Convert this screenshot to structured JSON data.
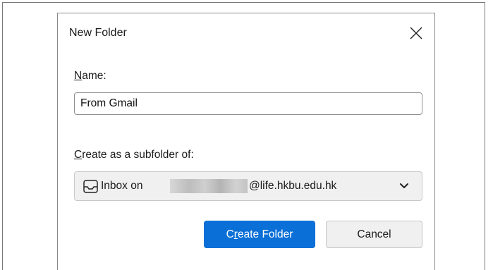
{
  "dialog": {
    "title": "New Folder",
    "close_icon": "close-icon"
  },
  "name_field": {
    "label_accesskey": "N",
    "label_rest": "ame:",
    "value": "From Gmail"
  },
  "subfolder": {
    "label_accesskey": "C",
    "label_rest": "reate as a subfolder of:",
    "icon": "inbox-icon",
    "selected_prefix": "Inbox on",
    "selected_suffix": "@life.hkbu.edu.hk",
    "dropdown_icon": "chevron-down-icon"
  },
  "buttons": {
    "create_pre": "C",
    "create_accesskey": "r",
    "create_post": "eate Folder",
    "cancel": "Cancel"
  },
  "colors": {
    "primary_button": "#0a6fd6",
    "secondary_button": "#f0f0f0"
  }
}
